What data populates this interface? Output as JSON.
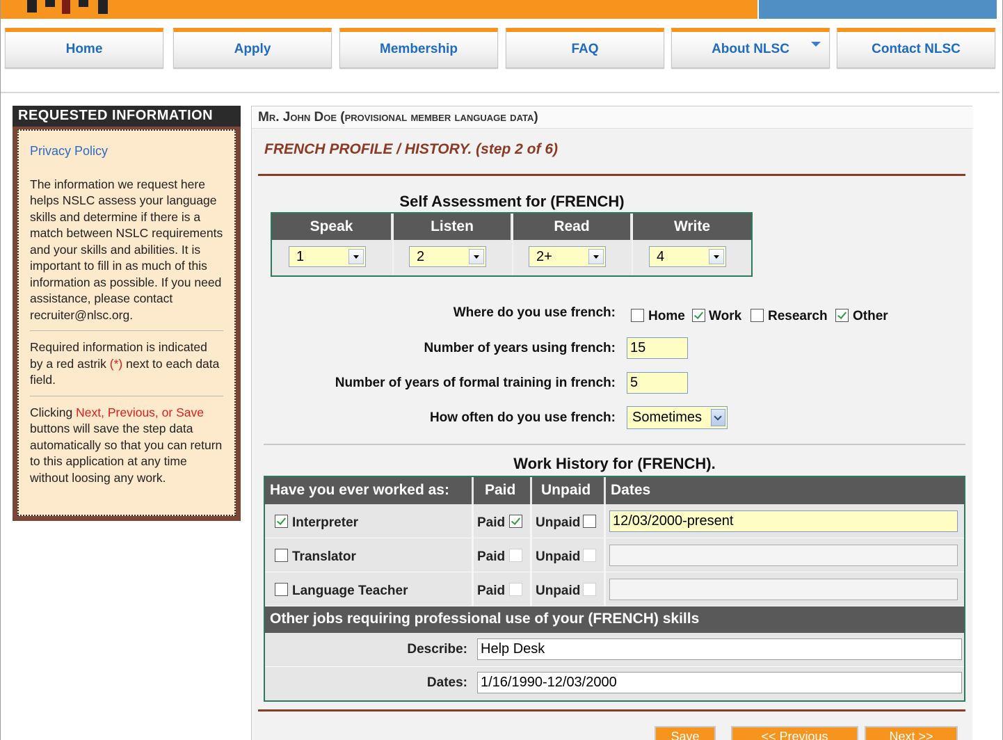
{
  "nav": {
    "tabs": [
      {
        "label": "Home"
      },
      {
        "label": "Apply"
      },
      {
        "label": "Membership"
      },
      {
        "label": "FAQ"
      },
      {
        "label": "About NLSC"
      },
      {
        "label": "Contact NLSC"
      }
    ]
  },
  "sidebar": {
    "title": "REQUESTED INFORMATION",
    "privacy_link": "Privacy Policy",
    "para1": "The information we request here helps NSLC assess your language skills and determine if there is a match between NSLC requirements and your skills and abilities. It is important to fill in as much of this information as possible. If you need assistance, please contact recruiter@nlsc.org.",
    "para2_a": "Required information is indicated by a red astrik ",
    "para2_star": "(*)",
    "para2_b": " next to each data field.",
    "para3_a": "Clicking ",
    "para3_red": "Next, Previous, or Save",
    "para3_b": " buttons will save the step data automatically so that you can return to this application at any time without loosing any work."
  },
  "main": {
    "header": "Mr. John Doe (provisional member language data)",
    "step": "FRENCH PROFILE / HISTORY. (step 2 of 6)"
  },
  "self_assessment": {
    "title": "Self Assessment for (FRENCH)",
    "columns": [
      {
        "header": "Speak",
        "value": "1"
      },
      {
        "header": "Listen",
        "value": "2"
      },
      {
        "header": "Read",
        "value": "2+"
      },
      {
        "header": "Write",
        "value": "4"
      }
    ]
  },
  "usage": {
    "where_label": "Where do you use french:",
    "where_options": [
      {
        "label": "Home",
        "checked": false
      },
      {
        "label": "Work",
        "checked": true
      },
      {
        "label": "Research",
        "checked": false
      },
      {
        "label": "Other",
        "checked": true
      }
    ],
    "years_label": "Number of years using french:",
    "years_value": "15",
    "training_label": "Number of years of formal training in french:",
    "training_value": "5",
    "often_label": "How often do you use french:",
    "often_value": "Sometimes"
  },
  "work_history": {
    "title": "Work History for (FRENCH).",
    "headers": {
      "role": "Have you ever worked as:",
      "paid": "Paid",
      "unpaid": "Unpaid",
      "dates": "Dates"
    },
    "rows": [
      {
        "role": "Interpreter",
        "role_checked": true,
        "paid_label": "Paid",
        "paid_checked": true,
        "unpaid_label": "Unpaid",
        "unpaid_checked": false,
        "dates": "12/03/2000-present"
      },
      {
        "role": "Translator",
        "role_checked": false,
        "paid_label": "Paid",
        "paid_checked": false,
        "unpaid_label": "Unpaid",
        "unpaid_checked": false,
        "dates": ""
      },
      {
        "role": "Language Teacher",
        "role_checked": false,
        "paid_label": "Paid",
        "paid_checked": false,
        "unpaid_label": "Unpaid",
        "unpaid_checked": false,
        "dates": ""
      }
    ],
    "other_header": "Other jobs requiring professional use of your (FRENCH) skills",
    "describe_label": "Describe:",
    "describe_value": "Help Desk",
    "dates_label": "Dates:",
    "dates_value": "1/16/1990-12/03/2000"
  },
  "buttons": {
    "save": "Save",
    "previous": "<< Previous",
    "next": "Next >>"
  }
}
